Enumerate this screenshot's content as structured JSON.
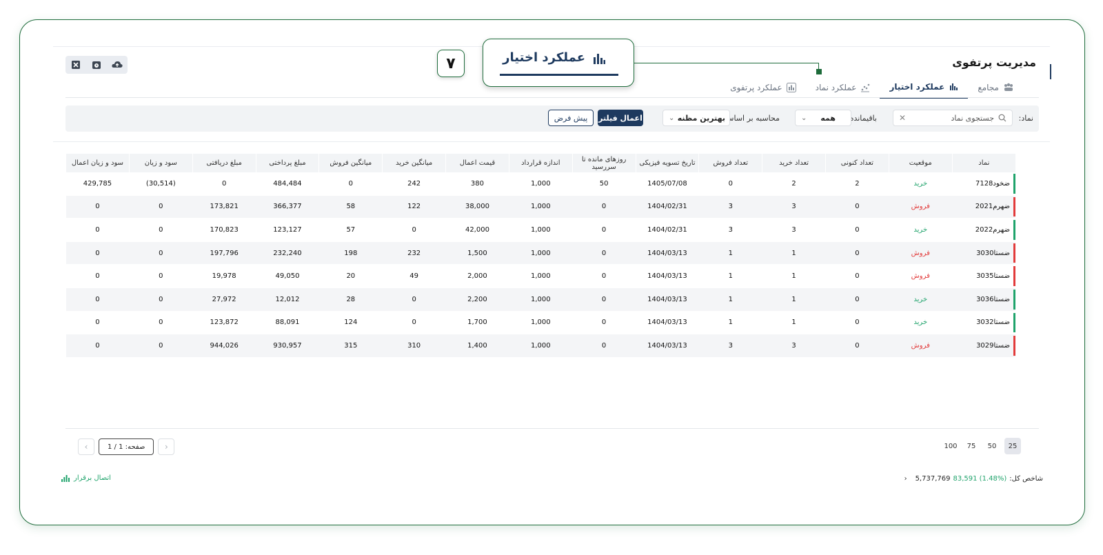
{
  "page_title": "مدیریت پرتفوی",
  "callout": {
    "label": "عملکرد اختیار",
    "step_number": "۷"
  },
  "tabs": [
    {
      "label": "عملکرد پرتفوی",
      "active": false,
      "icon": "bar-chart-icon"
    },
    {
      "label": "عملکرد نماد",
      "active": false,
      "icon": "scatter-chart-icon"
    },
    {
      "label": "عملکرد اختیار",
      "active": true,
      "icon": "bar-chart-icon"
    },
    {
      "label": "مجامع",
      "active": false,
      "icon": "meeting-icon"
    }
  ],
  "toolbar": {
    "icons": [
      "cloud-upload-icon",
      "history-icon",
      "excel-export-icon"
    ]
  },
  "filters": {
    "symbol_label": "نماد:",
    "symbol_placeholder": "جستجوی نماد",
    "remaining_label": "باقیمانده:",
    "remaining_value": "همه",
    "calc_label": "محاسبه بر اساس:",
    "calc_value": "بهترین مظنه",
    "apply_label": "اعمال فیلتر",
    "default_label": "پیش فرض"
  },
  "table": {
    "headers": [
      "نماد",
      "موقعیت",
      "تعداد کنونی",
      "تعداد خرید",
      "تعداد فروش",
      "تاریخ تسویه فیزیکی",
      "روزهای مانده تا سررسید",
      "اندازه قرارداد",
      "قیمت اعمال",
      "میانگین خرید",
      "میانگین فروش",
      "مبلغ پرداختی",
      "مبلغ دریافتی",
      "سود و زیان",
      "سود و زیان اعمال"
    ],
    "rows": [
      {
        "side": "buy",
        "cells": [
          "ضخود7128",
          "خرید",
          "2",
          "2",
          "0",
          "1405/07/08",
          "50",
          "1,000",
          "380",
          "242",
          "0",
          "484,484",
          "0",
          "(30,514)",
          "429,785"
        ]
      },
      {
        "side": "sell",
        "cells": [
          "ضهرم2021",
          "فروش",
          "0",
          "3",
          "3",
          "1404/02/31",
          "0",
          "1,000",
          "38,000",
          "122",
          "58",
          "366,377",
          "173,821",
          "0",
          "0"
        ]
      },
      {
        "side": "buy",
        "cells": [
          "ضهرم2022",
          "خرید",
          "0",
          "3",
          "3",
          "1404/02/31",
          "0",
          "1,000",
          "42,000",
          "0",
          "57",
          "123,127",
          "170,823",
          "0",
          "0"
        ]
      },
      {
        "side": "sell",
        "cells": [
          "ضستا3030",
          "فروش",
          "0",
          "1",
          "1",
          "1404/03/13",
          "0",
          "1,000",
          "1,500",
          "232",
          "198",
          "232,240",
          "197,796",
          "0",
          "0"
        ]
      },
      {
        "side": "sell",
        "cells": [
          "ضستا3035",
          "فروش",
          "0",
          "1",
          "1",
          "1404/03/13",
          "0",
          "1,000",
          "2,000",
          "49",
          "20",
          "49,050",
          "19,978",
          "0",
          "0"
        ]
      },
      {
        "side": "buy",
        "cells": [
          "ضستا3036",
          "خرید",
          "0",
          "1",
          "1",
          "1404/03/13",
          "0",
          "1,000",
          "2,200",
          "0",
          "28",
          "12,012",
          "27,972",
          "0",
          "0"
        ]
      },
      {
        "side": "buy",
        "cells": [
          "ضستا3032",
          "خرید",
          "0",
          "1",
          "1",
          "1404/03/13",
          "0",
          "1,000",
          "1,700",
          "0",
          "124",
          "88,091",
          "123,872",
          "0",
          "0"
        ]
      },
      {
        "side": "sell",
        "cells": [
          "ضستا3029",
          "فروش",
          "0",
          "3",
          "3",
          "1404/03/13",
          "0",
          "1,000",
          "1,400",
          "310",
          "315",
          "930,957",
          "944,026",
          "0",
          "0"
        ]
      }
    ]
  },
  "pagination": {
    "page_sizes": [
      "100",
      "75",
      "50",
      "25"
    ],
    "active_size": "25",
    "page_info": "صفحه: 1 / 1"
  },
  "status": {
    "index_label": "شاخص کل:",
    "index_value": "5,737,769",
    "index_change": "83,591",
    "index_change_pct": "(1.48%)",
    "connection": "اتصال برقرار"
  },
  "colors": {
    "brand": "#1e3a5f",
    "buy": "#1fa36b",
    "sell": "#e23b3b",
    "frame": "#1d6b3a"
  }
}
